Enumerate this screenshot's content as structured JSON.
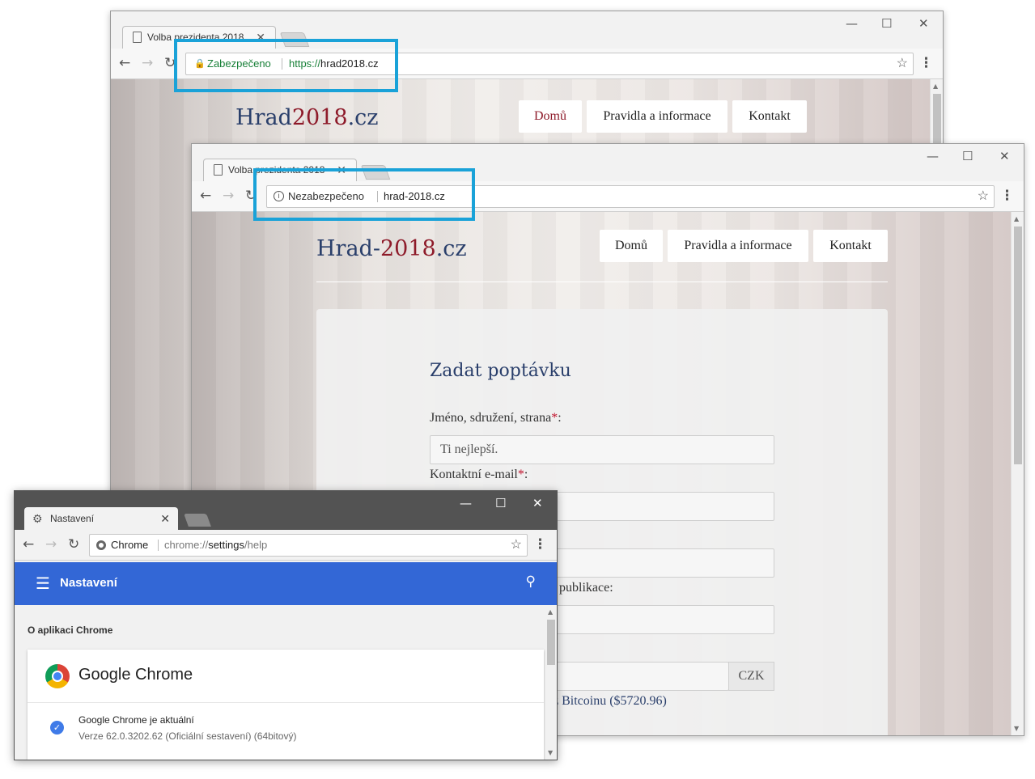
{
  "back_window": {
    "tab_title": "Volba prezidenta 2018",
    "security_label": "Zabezpečeno",
    "url_scheme": "https://",
    "url_host": "hrad2018.cz",
    "security_color": "#188038",
    "logo_a": "Hrad",
    "logo_b": "2018",
    "logo_c": ".cz",
    "nav": [
      "Domů",
      "Pravidla a informace",
      "Kontakt"
    ]
  },
  "front_window": {
    "tab_title": "Volba prezidenta 2018",
    "security_label": "Nezabezpečeno",
    "url": "hrad-2018.cz",
    "logo_a": "Hrad-",
    "logo_b": "2018",
    "logo_c": ".cz",
    "nav": [
      "Domů",
      "Pravidla a informace",
      "Kontakt"
    ],
    "form": {
      "title": "Zadat poptávku",
      "name_label": "Jméno, sdružení, strana",
      "name_value": "Ti nejlepší.",
      "email_label": "Kontaktní e-mail",
      "required_mark": "*",
      "colon": ":",
      "pub_label_fragment": ", publikace:",
      "currency": "CZK",
      "bitcoin_fragment": "z Bitcoinu ($5720.96)"
    }
  },
  "chrome_window": {
    "tab_title": "Nastavení",
    "omni_label": "Chrome",
    "url_scheme": "chrome://",
    "url_host": "settings",
    "url_path": "/help",
    "header_title": "Nastavení",
    "section_title": "O aplikaci Chrome",
    "product_name": "Google Chrome",
    "status": "Google Chrome je aktuální",
    "version": "Verze 62.0.3202.62 (Oficiální sestavení) (64bitový)"
  },
  "colors": {
    "highlight": "#1aa2d8",
    "chrome_header": "#3367d6",
    "logo_blue": "#2a3f6b",
    "logo_red": "#8e1b2a"
  }
}
